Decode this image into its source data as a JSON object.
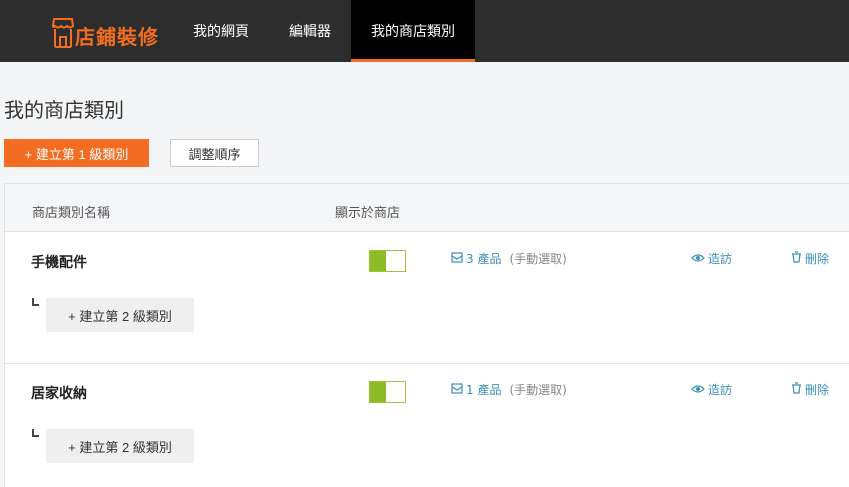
{
  "header": {
    "logo_text": "店鋪裝修",
    "nav": [
      {
        "label": "我的網頁"
      },
      {
        "label": "編輯器"
      },
      {
        "label": "我的商店類別"
      }
    ],
    "active_tab": "我的商店類別",
    "accent_color": "#f26c21"
  },
  "page": {
    "title": "我的商店類別",
    "create_button": "+ 建立第 1 級類別",
    "reorder_button": "調整順序"
  },
  "table": {
    "columns": [
      "商店類別名稱",
      "顯示於商店"
    ],
    "rows": [
      {
        "name": "手機配件",
        "visible": true,
        "products_count": "3 產品",
        "products_mode": "(手動選取)",
        "visit": "造訪",
        "delete": "刪除",
        "sub_button": "+ 建立第 2 級類別"
      },
      {
        "name": "居家收納",
        "visible": true,
        "products_count": "1 產品",
        "products_mode": "(手動選取)",
        "visit": "造訪",
        "delete": "刪除",
        "sub_button": "+ 建立第 2 級類別"
      }
    ]
  },
  "icons": {
    "logo": "storefront-icon",
    "products": "box-icon",
    "visit": "eye-icon",
    "delete": "trash-icon"
  }
}
